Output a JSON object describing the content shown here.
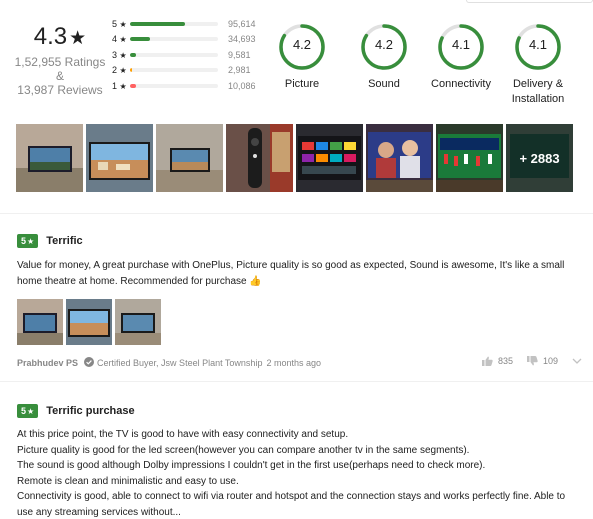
{
  "summary": {
    "average": "4.3",
    "star": "★",
    "ratings_count": "1,52,955 Ratings",
    "amp": "&",
    "reviews_count": "13,987 Reviews"
  },
  "distribution": [
    {
      "stars": "5",
      "count": "95,614",
      "fraction": 0.625,
      "color": "#388e3c"
    },
    {
      "stars": "4",
      "count": "34,693",
      "fraction": 0.227,
      "color": "#388e3c"
    },
    {
      "stars": "3",
      "count": "9,581",
      "fraction": 0.063,
      "color": "#388e3c"
    },
    {
      "stars": "2",
      "count": "2,981",
      "fraction": 0.019,
      "color": "#ff9f00"
    },
    {
      "stars": "1",
      "count": "10,086",
      "fraction": 0.066,
      "color": "#ff6161"
    }
  ],
  "aspects": [
    {
      "value": "4.2",
      "label": "Picture",
      "score": 4.2
    },
    {
      "value": "4.2",
      "label": "Sound",
      "score": 4.2
    },
    {
      "value": "4.1",
      "label": "Connectivity",
      "score": 4.1
    },
    {
      "value": "4.1",
      "label": "Delivery & Installation",
      "score": 4.1
    }
  ],
  "gallery": {
    "more_label": "+ 2883"
  },
  "reviews": [
    {
      "rating": "5",
      "star": "★",
      "title": "Terrific",
      "body": "Value for money, A great purchase with OnePlus, Picture quality is so good as expected, Sound is awesome, It's like a small home theatre at home. Recommended for purchase 👍",
      "author": "Prabhudev PS",
      "certified": "Certified Buyer, Jsw Steel Plant Township",
      "time": "2 months ago",
      "likes": "835",
      "dislikes": "109"
    },
    {
      "rating": "5",
      "star": "★",
      "title": "Terrific purchase",
      "body_lines": [
        "At this price point, the TV is good to have with easy connectivity and setup.",
        "Picture quality is good for the led screen(however you can compare another tv in the same segments).",
        "The sound is good although Dolby impressions I couldn't get in the first use(perhaps need to check more).",
        "Remote is clean and minimalistic and easy to use.",
        "Connectivity is good, able to connect to wifi via router and hotspot and the connection stays and works perfectly fine. Able to use any streaming services without..."
      ]
    }
  ],
  "colors": {
    "accent_green": "#388e3c",
    "muted": "#878787"
  }
}
